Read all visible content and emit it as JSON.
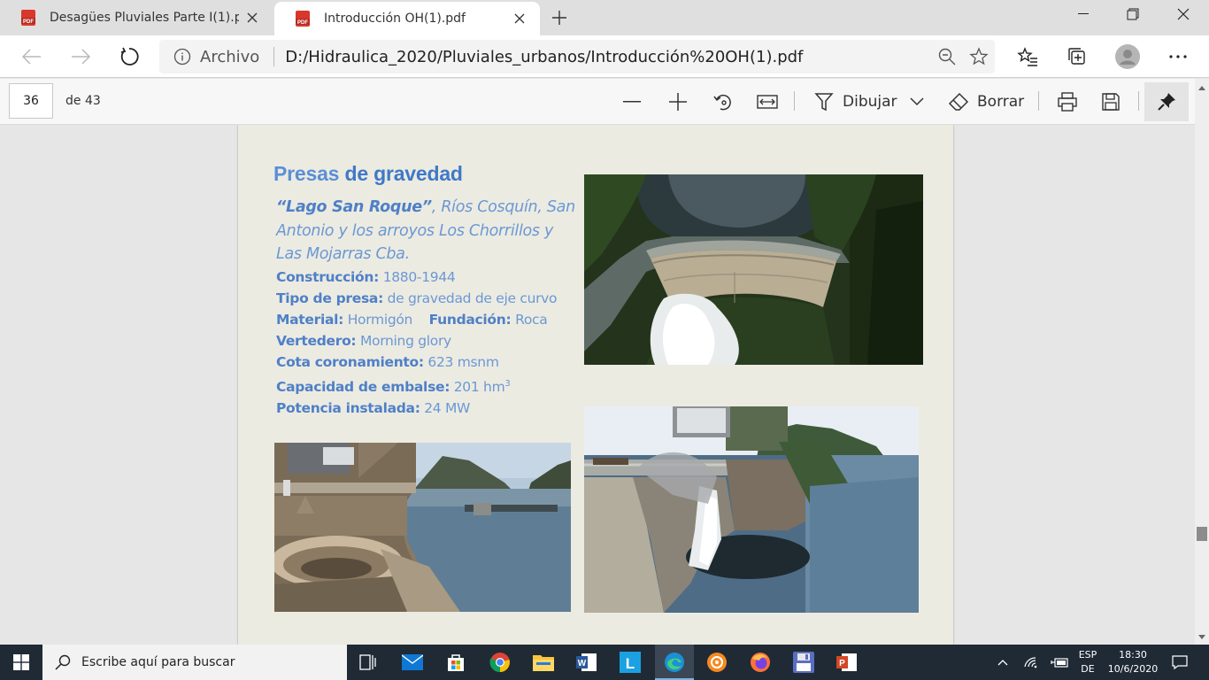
{
  "tabs": [
    {
      "title": "Desagües Pluviales Parte I(1).pdf",
      "active": false
    },
    {
      "title": "Introducción OH(1).pdf",
      "active": true
    }
  ],
  "address": {
    "label": "Archivo",
    "url": "D:/Hidraulica_2020/Pluviales_urbanos/Introducción%20OH(1).pdf"
  },
  "pdf_toolbar": {
    "page": "36",
    "of": "de 43",
    "draw": "Dibujar",
    "erase": "Borrar"
  },
  "slide": {
    "title_a": "Presas",
    "title_b": "de gravedad",
    "intro_bold": "“Lago San Roque”",
    "intro_rest": ",  Ríos Cosquín, San Antonio y los arroyos Los Chorrillos y Las Mojarras Cba.",
    "construccion_k": "Construcción:",
    "construccion_v": "1880-1944",
    "tipo_k": "Tipo de presa:",
    "tipo_v": "de gravedad de eje curvo",
    "material_k": "Material:",
    "material_v": "Hormigón",
    "fundacion_k": "Fundación:",
    "fundacion_v": "Roca",
    "vertedero_k": "Vertedero:",
    "vertedero_v": "Morning glory",
    "cota_k": "Cota coronamiento:",
    "cota_v": "623 msnm",
    "capacidad_k": "Capacidad de embalse:",
    "capacidad_v": "201 hm",
    "capacidad_sup": "3",
    "potencia_k": "Potencia instalada:",
    "potencia_v": "24 MW"
  },
  "taskbar": {
    "search_placeholder": "Escribe aquí para buscar",
    "lang_top": "ESP",
    "lang_bottom": "DE",
    "time": "18:30",
    "date": "10/6/2020"
  },
  "colors": {
    "accent": "#3f79c7",
    "slide_bg": "#ecebe2",
    "taskbar": "#1f2a35"
  }
}
